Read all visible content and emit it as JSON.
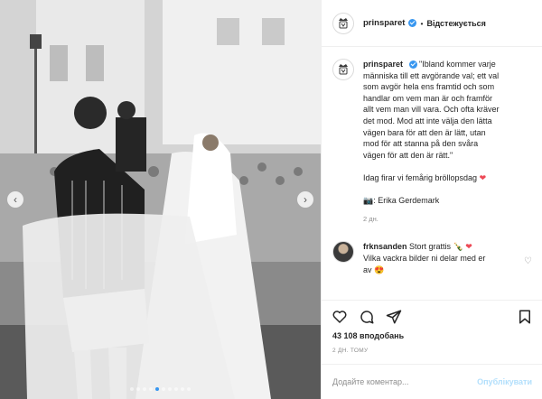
{
  "header": {
    "username": "prinsparet",
    "separator": "•",
    "follow_label": "Відстежується",
    "avatar_icon": "royal-monogram-icon"
  },
  "caption": {
    "username": "prinsparet",
    "lines": [
      "\"Ibland kommer varje",
      "människa till ett avgörande val; ett val",
      "som avgör hela ens framtid och som",
      "handlar om vem man är och framför",
      "allt vem man vill vara. Och ofta kräver",
      "det mod. Mod att inte välja den lätta",
      "vägen bara för att den är lätt, utan",
      "mod för att stanna på den svåra",
      "vägen för att den är rätt.\""
    ],
    "anniversary": "Idag firar vi femårig bröllopsdag",
    "photo_credit": "📷: Erika Gerdemark",
    "time": "2 дн."
  },
  "comment": {
    "username": "frknsanden",
    "text_line1": "Stort grattis 🍾",
    "text_line2": "Vilka vackra bilder ni delar med er",
    "text_line3": "av 😍"
  },
  "actions": {
    "like_icon": "heart-outline-icon",
    "comment_icon": "speech-bubble-icon",
    "share_icon": "paper-plane-icon",
    "save_icon": "bookmark-icon"
  },
  "likes": "43 108 вподобань",
  "posted": "2 ДН. ТОМУ",
  "add_comment": {
    "placeholder": "Додайте коментар...",
    "publish_label": "Опублікувати"
  },
  "carousel": {
    "dot_count": 10,
    "active_index": 4
  },
  "colors": {
    "accent": "#3897f0",
    "heart": "#ed4956",
    "publish_disabled": "#b2dffc"
  }
}
